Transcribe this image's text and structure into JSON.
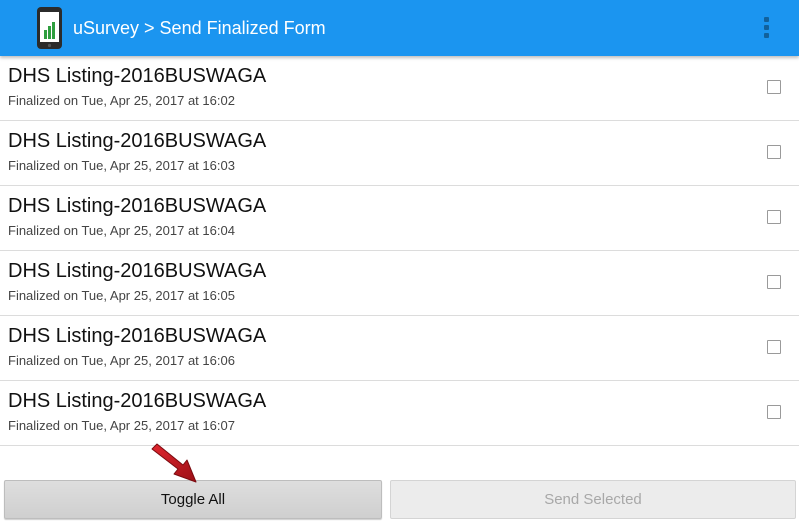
{
  "action_bar": {
    "title": "uSurvey > Send Finalized Form",
    "app_icon": "phone-chart-icon",
    "menu_icon": "overflow-menu-icon",
    "color": "#1b95f0"
  },
  "forms": [
    {
      "title": "DHS Listing-2016BUSWAGA",
      "subtitle": "Finalized on Tue, Apr 25, 2017 at 16:02",
      "checked": false
    },
    {
      "title": "DHS Listing-2016BUSWAGA",
      "subtitle": "Finalized on Tue, Apr 25, 2017 at 16:03",
      "checked": false
    },
    {
      "title": "DHS Listing-2016BUSWAGA",
      "subtitle": "Finalized on Tue, Apr 25, 2017 at 16:04",
      "checked": false
    },
    {
      "title": "DHS Listing-2016BUSWAGA",
      "subtitle": "Finalized on Tue, Apr 25, 2017 at 16:05",
      "checked": false
    },
    {
      "title": "DHS Listing-2016BUSWAGA",
      "subtitle": "Finalized on Tue, Apr 25, 2017 at 16:06",
      "checked": false
    },
    {
      "title": "DHS Listing-2016BUSWAGA",
      "subtitle": "Finalized on Tue, Apr 25, 2017 at 16:07",
      "checked": false
    }
  ],
  "buttons": {
    "toggle_all": "Toggle All",
    "send_selected": "Send Selected",
    "send_selected_enabled": false
  },
  "annotation": {
    "icon": "red-arrow-icon",
    "color": "#c0141c"
  }
}
